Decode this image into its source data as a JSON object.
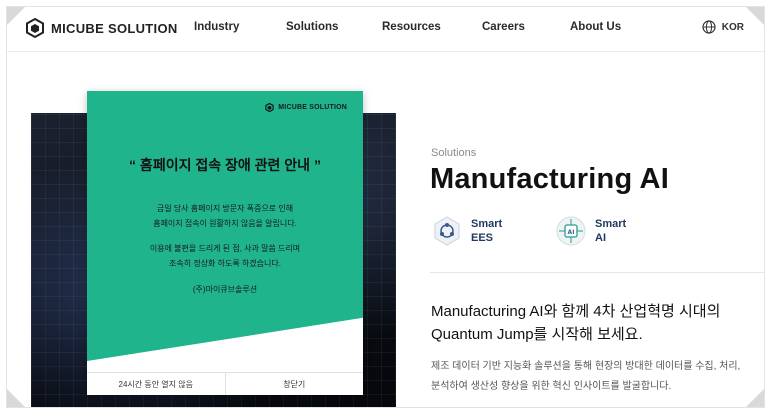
{
  "header": {
    "logo_text": "MICUBE SOLUTION",
    "nav": [
      "Industry",
      "Solutions",
      "Resources",
      "Careers",
      "About Us"
    ],
    "lang_label": "KOR"
  },
  "popup": {
    "logo_text": "MICUBE SOLUTION",
    "title": "“ 홈페이지 접속 장애 관련 안내 ”",
    "para1": [
      "금일 당사 홈페이지 방문자 폭증으로 인해",
      "홈페이지 접속이 원활하지 않음을 알립니다."
    ],
    "para2": [
      "이용에 불편을 드리게 된 점, 사과 말씀 드리며",
      "조속히 정상화 하도록 하겠습니다."
    ],
    "signature": "(주)마이큐브솔루션",
    "footer_left": "24시간 동안 열지 않음",
    "footer_right": "창닫기",
    "green_color": "#1fb48c"
  },
  "main": {
    "eyebrow": "Solutions",
    "title": "Manufacturing AI",
    "products": [
      {
        "line1": "Smart",
        "line2": "EES",
        "icon": "ees-icon"
      },
      {
        "line1": "Smart",
        "line2": "AI",
        "icon": "ai-chip-icon"
      }
    ],
    "headline_line1": "Manufacturing AI와 함께 4차 산업혁명 시대의",
    "headline_line2": "Quantum Jump를 시작해 보세요.",
    "desc_line1": "제조 데이터 기반 지능화 솔루션을 통해 현장의 방대한 데이터를 수집, 처리,",
    "desc_line2": "분석하여 생산성 향상을 위한 혁신 인사이트를 발굴합니다."
  }
}
